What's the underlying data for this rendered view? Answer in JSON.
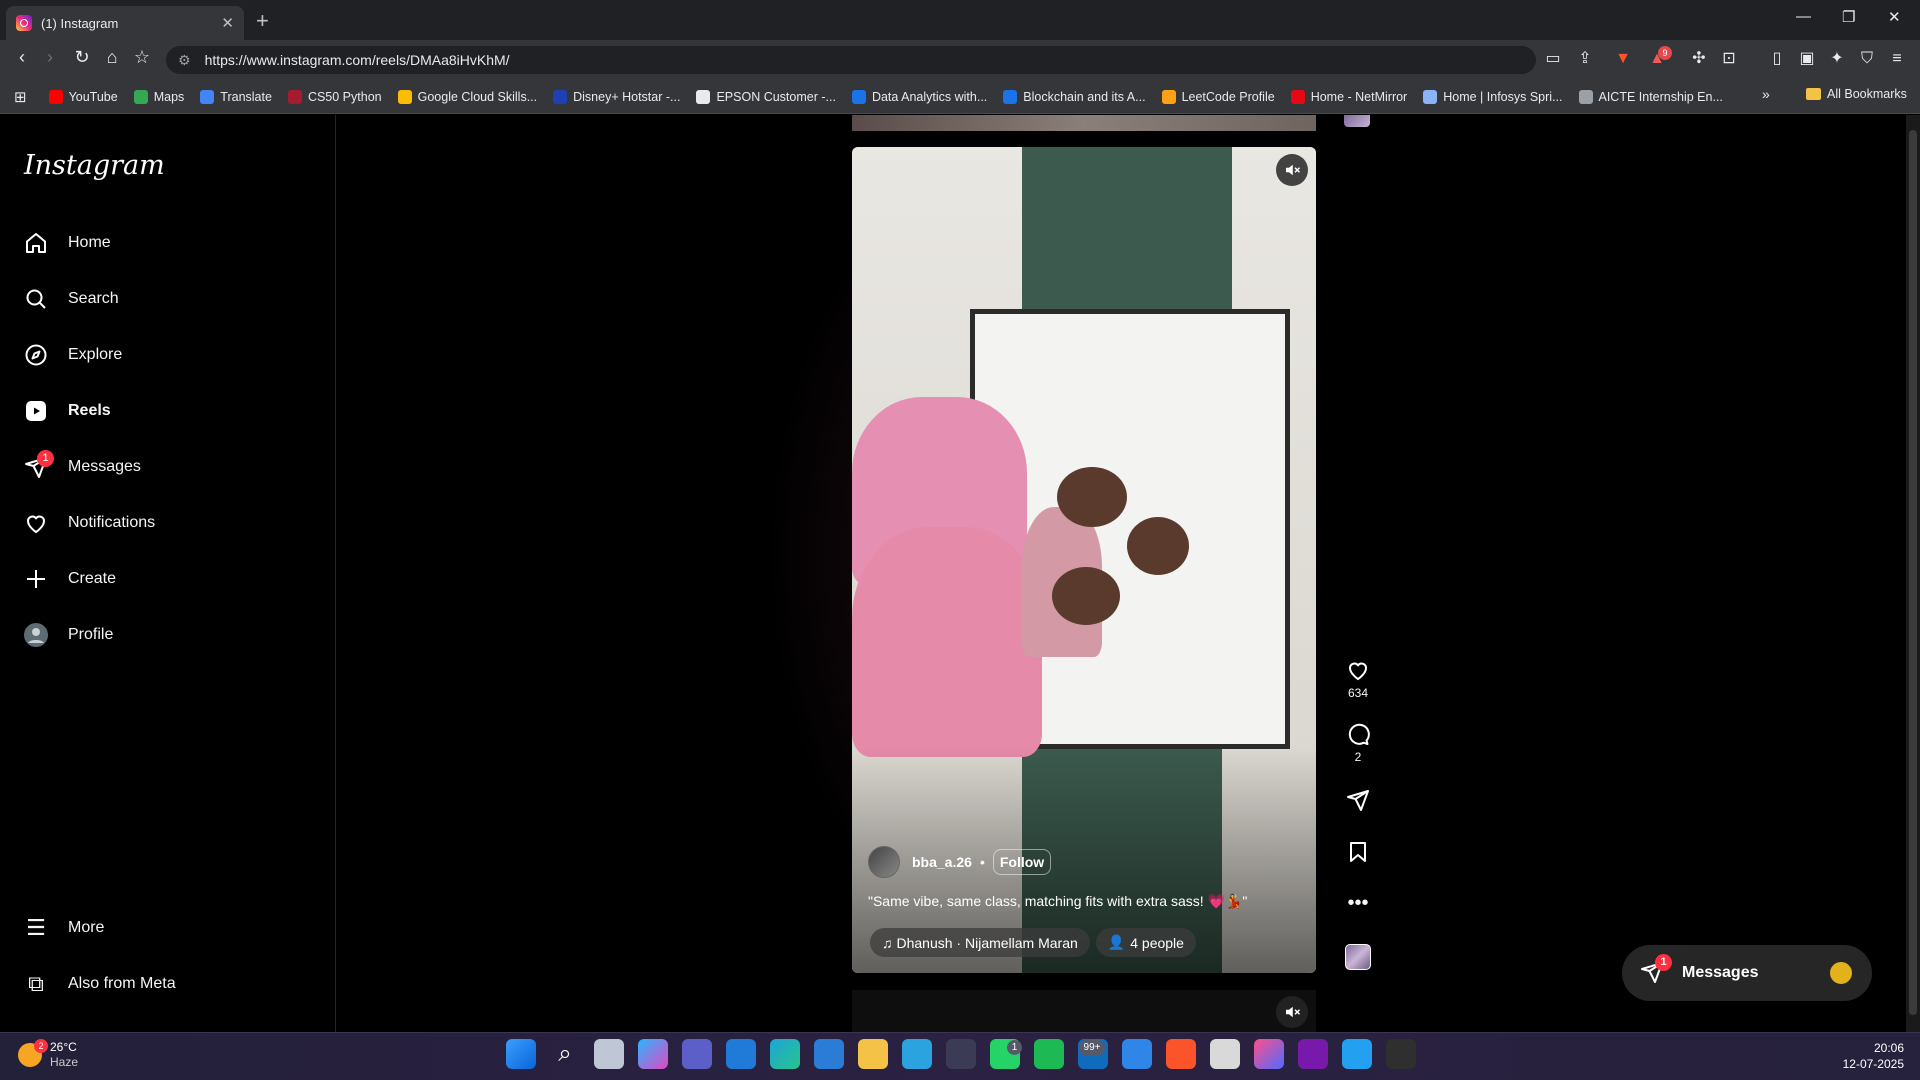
{
  "browser": {
    "tab_title": "(1) Instagram",
    "url": "https://www.instagram.com/reels/DMAa8iHvKhM/",
    "bookmarks": [
      {
        "label": "YouTube",
        "color": "#ff0000"
      },
      {
        "label": "Maps",
        "color": "#34a853"
      },
      {
        "label": "Translate",
        "color": "#4285f4"
      },
      {
        "label": "CS50 Python",
        "color": "#a51c30"
      },
      {
        "label": "Google Cloud Skills...",
        "color": "#fbbc04"
      },
      {
        "label": "Disney+ Hotstar -...",
        "color": "#1f3fb5"
      },
      {
        "label": "EPSON Customer -...",
        "color": "#e8eaed"
      },
      {
        "label": "Data Analytics with...",
        "color": "#1a73e8"
      },
      {
        "label": "Blockchain and its A...",
        "color": "#1a73e8"
      },
      {
        "label": "LeetCode Profile",
        "color": "#ffa116"
      },
      {
        "label": "Home - NetMirror",
        "color": "#e50914"
      },
      {
        "label": "Home | Infosys Spri...",
        "color": "#8ab4f8"
      },
      {
        "label": "AICTE Internship En...",
        "color": "#9aa0a6"
      }
    ],
    "all_bookmarks": "All Bookmarks",
    "brave_badge": "9"
  },
  "instagram": {
    "logo": "Instagram",
    "nav": [
      {
        "label": "Home",
        "icon": "home-icon"
      },
      {
        "label": "Search",
        "icon": "search-icon"
      },
      {
        "label": "Explore",
        "icon": "compass-icon"
      },
      {
        "label": "Reels",
        "icon": "reels-icon"
      },
      {
        "label": "Messages",
        "icon": "messenger-icon",
        "badge": "1"
      },
      {
        "label": "Notifications",
        "icon": "heart-icon"
      },
      {
        "label": "Create",
        "icon": "plus-icon"
      },
      {
        "label": "Profile",
        "icon": "avatar-icon"
      }
    ],
    "more": "More",
    "also_meta": "Also from Meta"
  },
  "reel": {
    "username": "bba_a.26",
    "separator": "•",
    "follow": "Follow",
    "caption": "\"Same vibe, same class, matching fits with extra sass! 💗💃\"",
    "audio": "Dhanush · Nijamellam Maran",
    "people": "4 people",
    "likes": "634",
    "comments": "2"
  },
  "messages_pill": {
    "label": "Messages",
    "badge": "1"
  },
  "taskbar": {
    "temp": "26°C",
    "condition": "Haze",
    "weather_badge": "2",
    "mail_badge": "99+",
    "whatsapp_badge": "1",
    "time": "20:06",
    "date": "12-07-2025"
  }
}
